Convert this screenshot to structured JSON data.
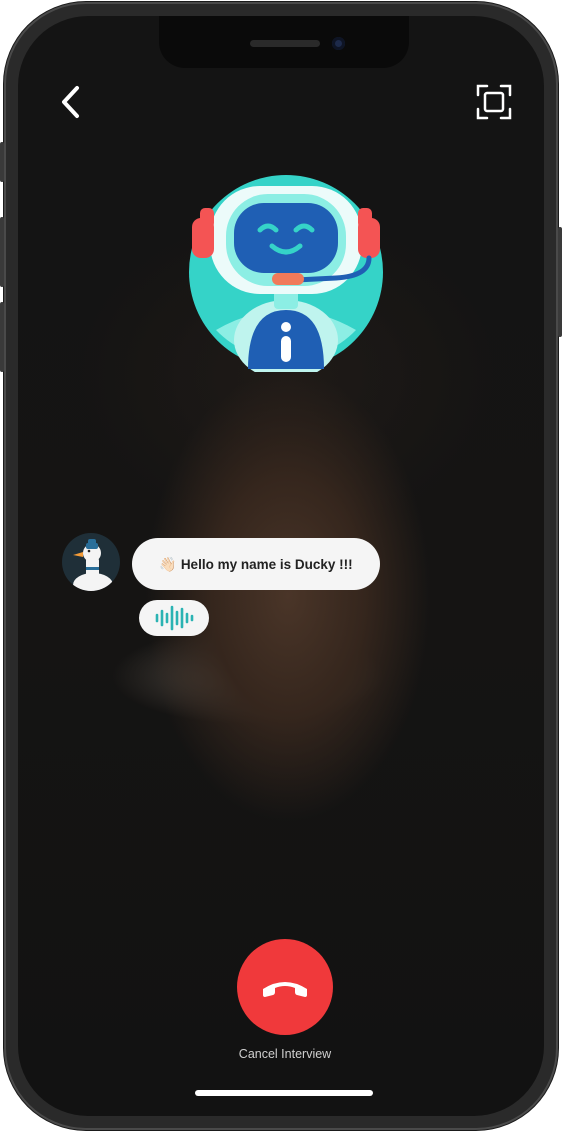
{
  "header": {
    "back_icon": "chevron-left-icon",
    "expand_icon": "fullscreen-frame-icon"
  },
  "assistant": {
    "avatar_icon": "robot-headset-icon",
    "chat_avatar_icon": "duck-avatar-icon"
  },
  "chat": {
    "message_emoji": "👋🏻",
    "message_text": "Hello my name is Ducky !!!",
    "voice_icon": "audio-waveform-icon"
  },
  "call": {
    "end_icon": "phone-hangup-icon",
    "cancel_label": "Cancel Interview"
  },
  "colors": {
    "accent_red": "#f0393b",
    "robot_teal": "#35d3c8",
    "robot_blue": "#1f5fb4",
    "headset_red": "#f45454",
    "waveform_teal": "#2bb3b3"
  }
}
